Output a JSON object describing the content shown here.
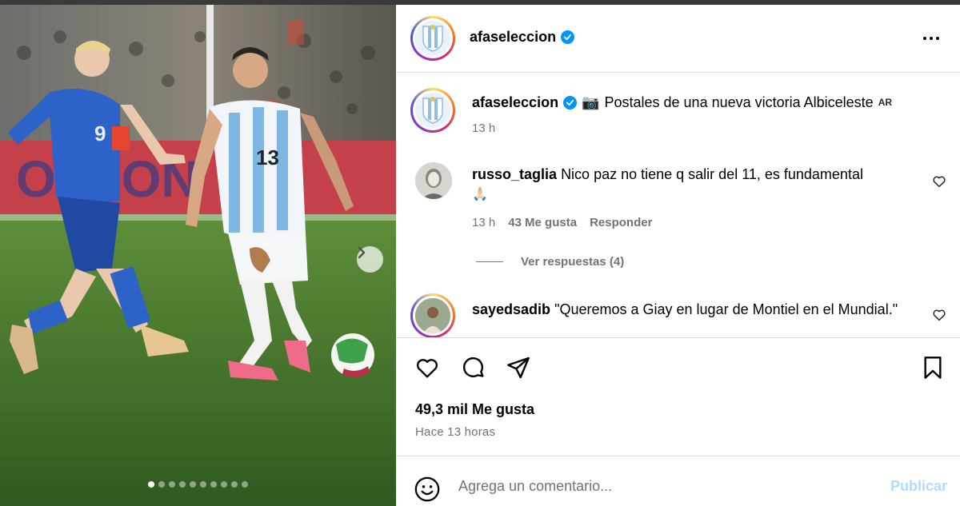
{
  "post": {
    "author": "afaseleccion",
    "author_verified": true,
    "more_icon": "more-horizontal-icon"
  },
  "caption": {
    "username": "afaseleccion",
    "camera_emoji": "📷",
    "text": "Postales de una nueva victoria Albiceleste",
    "locale_badge": "AR",
    "time": "13 h"
  },
  "comments": [
    {
      "username": "russo_taglia",
      "text": "Nico paz no tiene q salir del 11, es fundamental",
      "emoji": "🙏🏻",
      "time": "13 h",
      "likes": "43 Me gusta",
      "reply_label": "Responder",
      "view_replies": "Ver respuestas (4)"
    },
    {
      "username": "sayedsadib",
      "text": "\"Queremos a Giay en lugar de Montiel en el Mundial.\""
    }
  ],
  "photo": {
    "carousel_count": 10,
    "active_index": 0,
    "player_left_number": "9",
    "player_right_number": "13"
  },
  "actions": {
    "like_icon": "heart-icon",
    "comment_icon": "comment-icon",
    "share_icon": "share-icon",
    "save_icon": "bookmark-icon"
  },
  "stats": {
    "likes": "49,3 mil Me gusta",
    "posted": "Hace 13 horas"
  },
  "composer": {
    "placeholder": "Agrega un comentario...",
    "value": "",
    "publish_label": "Publicar"
  },
  "colors": {
    "verified": "#0095f6",
    "publish_disabled": "#b3dbff",
    "muted_text": "#737373",
    "divider": "#dbdbdb"
  }
}
